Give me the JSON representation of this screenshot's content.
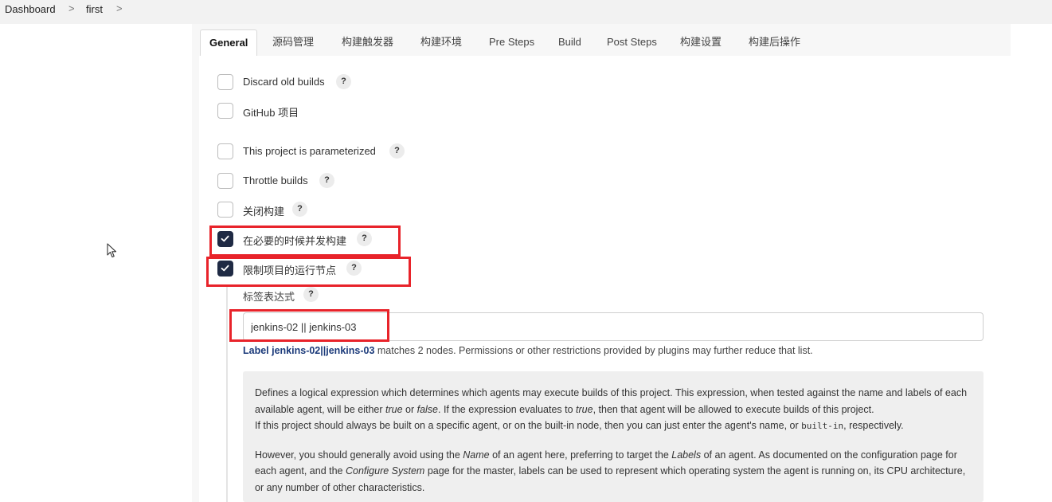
{
  "breadcrumb": {
    "root": "Dashboard",
    "sep": ">",
    "job": "first"
  },
  "tabs": [
    "General",
    "源码管理",
    "构建触发器",
    "构建环境",
    "Pre Steps",
    "Build",
    "Post Steps",
    "构建设置",
    "构建后操作"
  ],
  "help_icon": "?",
  "options": [
    {
      "label": "Discard old builds",
      "checked": false
    },
    {
      "label": "GitHub 项目",
      "checked": false
    },
    {
      "label": "This project is parameterized",
      "checked": false
    },
    {
      "label": "Throttle builds",
      "checked": false
    },
    {
      "label": "关闭构建",
      "checked": false
    },
    {
      "label": "在必要的时候并发构建",
      "checked": true
    },
    {
      "label": "限制项目的运行节点",
      "checked": true
    }
  ],
  "label_expression": {
    "label": "标签表达式",
    "value": "jenkins-02 || jenkins-03",
    "match_link": "Label jenkins-02||jenkins-03",
    "match_text": " matches 2 nodes. Permissions or other restrictions provided by plugins may further reduce that list."
  },
  "help_text": {
    "p1_a": "Defines a logical expression which determines which agents may execute builds of this project. This expression, when tested against the name and labels of each available agent, will be either ",
    "p1_true": "true",
    "p1_b": " or ",
    "p1_false": "false",
    "p1_c": ". If the expression evaluates to ",
    "p1_true2": "true",
    "p1_d": ", then that agent will be allowed to execute builds of this project.",
    "p1_e": "If this project should always be built on a specific agent, or on the built-in node, then you can just enter the agent's name, or ",
    "p1_code": "built-in",
    "p1_f": ", respectively.",
    "p2_a": "However, you should generally avoid using the ",
    "p2_name": "Name",
    "p2_b": " of an agent here, preferring to target the ",
    "p2_labels": "Labels",
    "p2_c": " of an agent. As documented on the configuration page for each agent, and the ",
    "p2_configure": "Configure System",
    "p2_d": " page for the master, labels can be used to represent which operating system the agent is running on, its CPU architecture, or any number of other characteristics."
  },
  "colors": {
    "highlight": "#e8232a",
    "checked": "#1f2a44",
    "link": "#1b3a7a"
  }
}
